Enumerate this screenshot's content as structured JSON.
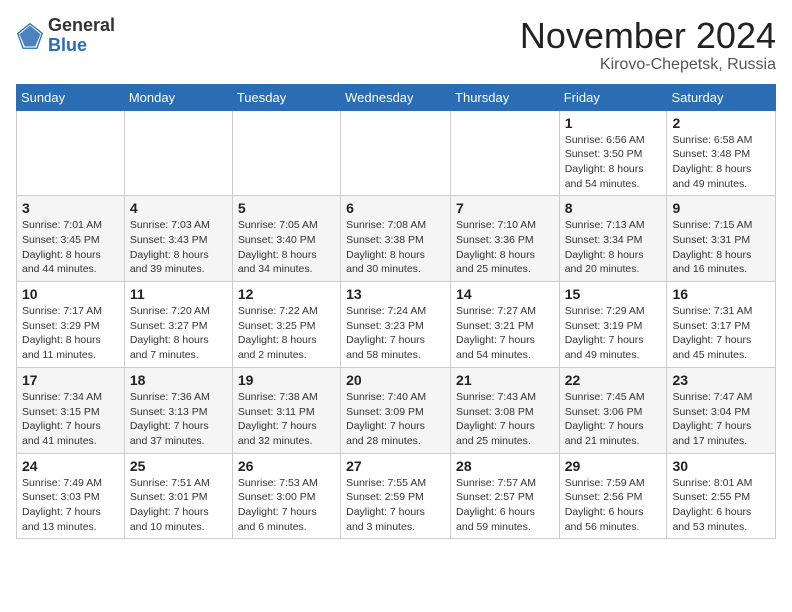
{
  "header": {
    "logo_general": "General",
    "logo_blue": "Blue",
    "month_title": "November 2024",
    "location": "Kirovo-Chepetsk, Russia"
  },
  "weekdays": [
    "Sunday",
    "Monday",
    "Tuesday",
    "Wednesday",
    "Thursday",
    "Friday",
    "Saturday"
  ],
  "weeks": [
    [
      {
        "day": "",
        "info": ""
      },
      {
        "day": "",
        "info": ""
      },
      {
        "day": "",
        "info": ""
      },
      {
        "day": "",
        "info": ""
      },
      {
        "day": "",
        "info": ""
      },
      {
        "day": "1",
        "info": "Sunrise: 6:56 AM\nSunset: 3:50 PM\nDaylight: 8 hours and 54 minutes."
      },
      {
        "day": "2",
        "info": "Sunrise: 6:58 AM\nSunset: 3:48 PM\nDaylight: 8 hours and 49 minutes."
      }
    ],
    [
      {
        "day": "3",
        "info": "Sunrise: 7:01 AM\nSunset: 3:45 PM\nDaylight: 8 hours and 44 minutes."
      },
      {
        "day": "4",
        "info": "Sunrise: 7:03 AM\nSunset: 3:43 PM\nDaylight: 8 hours and 39 minutes."
      },
      {
        "day": "5",
        "info": "Sunrise: 7:05 AM\nSunset: 3:40 PM\nDaylight: 8 hours and 34 minutes."
      },
      {
        "day": "6",
        "info": "Sunrise: 7:08 AM\nSunset: 3:38 PM\nDaylight: 8 hours and 30 minutes."
      },
      {
        "day": "7",
        "info": "Sunrise: 7:10 AM\nSunset: 3:36 PM\nDaylight: 8 hours and 25 minutes."
      },
      {
        "day": "8",
        "info": "Sunrise: 7:13 AM\nSunset: 3:34 PM\nDaylight: 8 hours and 20 minutes."
      },
      {
        "day": "9",
        "info": "Sunrise: 7:15 AM\nSunset: 3:31 PM\nDaylight: 8 hours and 16 minutes."
      }
    ],
    [
      {
        "day": "10",
        "info": "Sunrise: 7:17 AM\nSunset: 3:29 PM\nDaylight: 8 hours and 11 minutes."
      },
      {
        "day": "11",
        "info": "Sunrise: 7:20 AM\nSunset: 3:27 PM\nDaylight: 8 hours and 7 minutes."
      },
      {
        "day": "12",
        "info": "Sunrise: 7:22 AM\nSunset: 3:25 PM\nDaylight: 8 hours and 2 minutes."
      },
      {
        "day": "13",
        "info": "Sunrise: 7:24 AM\nSunset: 3:23 PM\nDaylight: 7 hours and 58 minutes."
      },
      {
        "day": "14",
        "info": "Sunrise: 7:27 AM\nSunset: 3:21 PM\nDaylight: 7 hours and 54 minutes."
      },
      {
        "day": "15",
        "info": "Sunrise: 7:29 AM\nSunset: 3:19 PM\nDaylight: 7 hours and 49 minutes."
      },
      {
        "day": "16",
        "info": "Sunrise: 7:31 AM\nSunset: 3:17 PM\nDaylight: 7 hours and 45 minutes."
      }
    ],
    [
      {
        "day": "17",
        "info": "Sunrise: 7:34 AM\nSunset: 3:15 PM\nDaylight: 7 hours and 41 minutes."
      },
      {
        "day": "18",
        "info": "Sunrise: 7:36 AM\nSunset: 3:13 PM\nDaylight: 7 hours and 37 minutes."
      },
      {
        "day": "19",
        "info": "Sunrise: 7:38 AM\nSunset: 3:11 PM\nDaylight: 7 hours and 32 minutes."
      },
      {
        "day": "20",
        "info": "Sunrise: 7:40 AM\nSunset: 3:09 PM\nDaylight: 7 hours and 28 minutes."
      },
      {
        "day": "21",
        "info": "Sunrise: 7:43 AM\nSunset: 3:08 PM\nDaylight: 7 hours and 25 minutes."
      },
      {
        "day": "22",
        "info": "Sunrise: 7:45 AM\nSunset: 3:06 PM\nDaylight: 7 hours and 21 minutes."
      },
      {
        "day": "23",
        "info": "Sunrise: 7:47 AM\nSunset: 3:04 PM\nDaylight: 7 hours and 17 minutes."
      }
    ],
    [
      {
        "day": "24",
        "info": "Sunrise: 7:49 AM\nSunset: 3:03 PM\nDaylight: 7 hours and 13 minutes."
      },
      {
        "day": "25",
        "info": "Sunrise: 7:51 AM\nSunset: 3:01 PM\nDaylight: 7 hours and 10 minutes."
      },
      {
        "day": "26",
        "info": "Sunrise: 7:53 AM\nSunset: 3:00 PM\nDaylight: 7 hours and 6 minutes."
      },
      {
        "day": "27",
        "info": "Sunrise: 7:55 AM\nSunset: 2:59 PM\nDaylight: 7 hours and 3 minutes."
      },
      {
        "day": "28",
        "info": "Sunrise: 7:57 AM\nSunset: 2:57 PM\nDaylight: 6 hours and 59 minutes."
      },
      {
        "day": "29",
        "info": "Sunrise: 7:59 AM\nSunset: 2:56 PM\nDaylight: 6 hours and 56 minutes."
      },
      {
        "day": "30",
        "info": "Sunrise: 8:01 AM\nSunset: 2:55 PM\nDaylight: 6 hours and 53 minutes."
      }
    ]
  ]
}
